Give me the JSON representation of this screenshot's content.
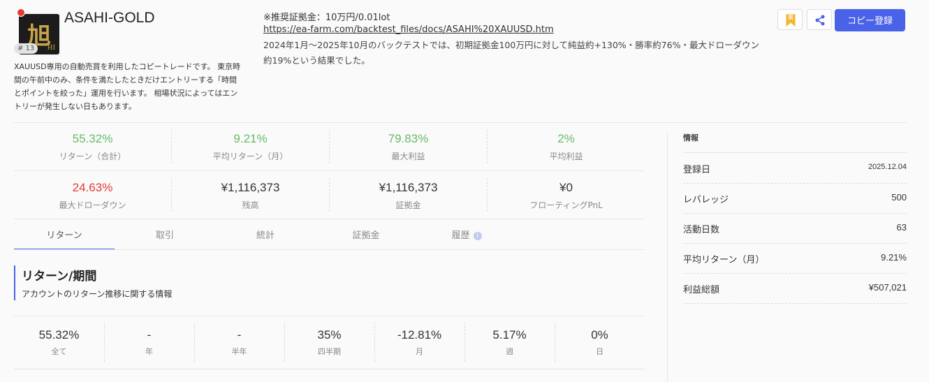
{
  "header": {
    "title": "ASAHI-GOLD",
    "rank": "# 13",
    "logo_kanji": "旭",
    "logo_text": "HI",
    "description": "XAUUSD専用の自動売買を利用したコピートレードです。 東京時間の午前中のみ、条件を満たしたときだけエントリーする「時間とポイントを絞った」運用を行います。 相場状況によってはエントリーが発生しない日もあります。",
    "recommended_margin": "※推奨証拠金：10万円/0.01lot",
    "backtest_link": "https://ea-farm.com/backtest_files/docs/ASAHI%20XAUUSD.htm",
    "backtest_summary": "2024年1月～2025年10月のバックテストでは、初期証拠金100万円に対して純益約+130%・勝率約76%・最大ドローダウン約19%という結果でした。",
    "copy_button": "コピー登録",
    "flag_color": "#e53935",
    "accent_color": "#4a62e8"
  },
  "stats": [
    {
      "value": "55.32%",
      "label": "リターン（合計）",
      "color": "green"
    },
    {
      "value": "9.21%",
      "label": "平均リターン（月）",
      "color": "green"
    },
    {
      "value": "79.83%",
      "label": "最大利益",
      "color": "green"
    },
    {
      "value": "2%",
      "label": "平均利益",
      "color": "green"
    },
    {
      "value": "24.63%",
      "label": "最大ドローダウン",
      "color": "red"
    },
    {
      "value": "¥1,116,373",
      "label": "残高",
      "color": "default"
    },
    {
      "value": "¥1,116,373",
      "label": "証拠金",
      "color": "default"
    },
    {
      "value": "¥0",
      "label": "フローティングPnL",
      "color": "default"
    }
  ],
  "tabs": [
    {
      "label": "リターン"
    },
    {
      "label": "取引"
    },
    {
      "label": "統計"
    },
    {
      "label": "証拠金"
    },
    {
      "label": "履歴"
    }
  ],
  "section": {
    "title": "リターン/期間",
    "subtitle": "アカウントのリターン推移に関する情報"
  },
  "periods": [
    {
      "value": "55.32%",
      "label": "全て"
    },
    {
      "value": "-",
      "label": "年"
    },
    {
      "value": "-",
      "label": "半年"
    },
    {
      "value": "35%",
      "label": "四半期"
    },
    {
      "value": "-12.81%",
      "label": "月"
    },
    {
      "value": "5.17%",
      "label": "週"
    },
    {
      "value": "0%",
      "label": "日"
    }
  ],
  "info_panel": {
    "heading": "情報",
    "rows": [
      {
        "key": "登録日",
        "value": "2025.12.04"
      },
      {
        "key": "レバレッジ",
        "value": "500"
      },
      {
        "key": "活動日数",
        "value": "63"
      },
      {
        "key": "平均リターン（月）",
        "value": "9.21%"
      },
      {
        "key": "利益総額",
        "value": "¥507,021"
      }
    ]
  },
  "icons": {
    "bookmark": "bookmark-icon",
    "share": "share-icon",
    "info": "info-icon"
  }
}
